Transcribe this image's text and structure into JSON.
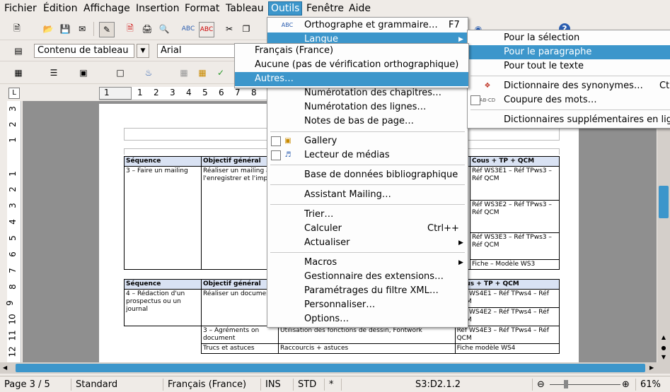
{
  "menubar": [
    "Fichier",
    "Édition",
    "Affichage",
    "Insertion",
    "Format",
    "Tableau",
    "Outils",
    "Fenêtre",
    "Aide"
  ],
  "toolbar2": {
    "style_value": "Contenu de tableau",
    "font_value": "Arial"
  },
  "ruler": {
    "h": [
      "1",
      "1",
      "2",
      "3",
      "4",
      "5",
      "6",
      "7",
      "8"
    ],
    "v": [
      "3",
      "2",
      "1",
      "1",
      "2",
      "3",
      "4",
      "5",
      "6",
      "7",
      "8",
      "9",
      "10",
      "11",
      "12"
    ]
  },
  "doc": {
    "table1": {
      "headers": [
        "Séquence",
        "Objectif général",
        "Cous + TP + QCM"
      ],
      "seq": "3 – Faire un mailing",
      "obj": "Réaliser un mailing à partir d'une lettre type et d'une base de données, l'enregistrer et l'imprimer",
      "refs": [
        "Réf WS3E1 – Réf TPws3 – Réf QCM",
        "Réf WS3E2 – Réf TPws3 – Réf QCM",
        "Réf WS3E3 – Réf TPws3 – Réf QCM",
        "Fiche – Modèle WS3"
      ]
    },
    "table2": {
      "headers": [
        "Séquence",
        "Objectif général",
        "Cous + TP + QCM"
      ],
      "seq": "4 – Rédaction d'un prospectus ou un journal",
      "obj": "Réaliser un document présenté et utilisant les fonctions de PAO et Fontwork",
      "refs": [
        "Réf WS4E1 – Réf TPws4 – Réf QCM",
        "Réf WS4E2 – Réf TPws4 – Réf QCM",
        "Réf WS4E3 – Réf TPws4 – Réf QCM",
        "Fiche modèle WS4"
      ],
      "row3": [
        "3 – Agréments on document",
        "Utilisation des fonctions de dessin, Fontwork"
      ],
      "row4": [
        "Trucs et astuces",
        "Raccourcis + astuces"
      ]
    }
  },
  "outils_menu": [
    {
      "label": "Orthographe et grammaire…",
      "shortcut": "F7"
    },
    {
      "label": "Langue"
    },
    {
      "label": "Numérotation des chapitres…"
    },
    {
      "label": "Numérotation des lignes…"
    },
    {
      "label": "Notes de bas de page…"
    },
    {
      "label": "Gallery"
    },
    {
      "label": "Lecteur de médias"
    },
    {
      "label": "Base de données bibliographique"
    },
    {
      "label": "Assistant Mailing…"
    },
    {
      "label": "Trier…"
    },
    {
      "label": "Calculer",
      "shortcut": "Ctrl++"
    },
    {
      "label": "Actualiser"
    },
    {
      "label": "Macros"
    },
    {
      "label": "Gestionnaire des extensions…"
    },
    {
      "label": "Paramétrages du filtre XML…"
    },
    {
      "label": "Personnaliser…"
    },
    {
      "label": "Options…"
    }
  ],
  "langue_menu": [
    "Pour la sélection",
    "Pour le paragraphe",
    "Pour tout le texte",
    "Dictionnaire des synonymes…",
    "Coupure des mots…",
    "Dictionnaires supplémentaires en lig"
  ],
  "langue_shortcut": "Ct",
  "paragraphe_menu": [
    "Français (France)",
    "Aucune (pas de vérification orthographique)",
    "Autres…"
  ],
  "status": {
    "page": "Page 3 / 5",
    "style": "Standard",
    "language": "Français (France)",
    "ins": "INS",
    "std": "STD",
    "star": "*",
    "cell": "S3:D2.1.2",
    "zoom": "61%"
  }
}
